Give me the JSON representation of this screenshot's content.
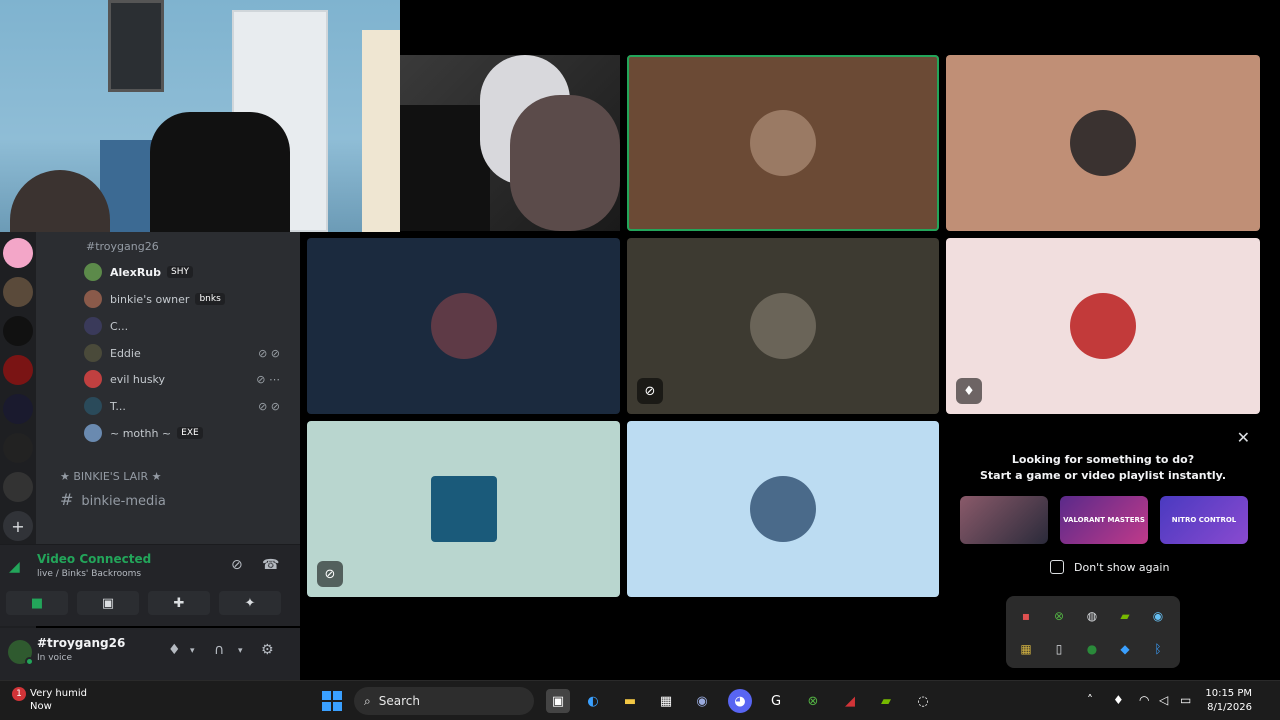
{
  "channels": {
    "text_channel": "#troygang26",
    "members": [
      {
        "name": "AlexRub",
        "tag": "SHY",
        "bright": true
      },
      {
        "name": "binkie's owner",
        "tag": "bnks",
        "bright": false
      },
      {
        "name": "C...",
        "tag": "",
        "bright": false
      },
      {
        "name": "Eddie",
        "tag": "",
        "bright": false
      },
      {
        "name": "evil husky",
        "tag": "",
        "bright": false
      },
      {
        "name": "T...",
        "tag": "",
        "bright": false
      },
      {
        "name": "~ mothh ~",
        "tag": "EXE",
        "bright": false
      }
    ],
    "category": "★ BINKIE'S LAIR ★",
    "media_channel": "binkie-media"
  },
  "voice": {
    "status": "Video Connected",
    "location": "live / Binks' Backrooms"
  },
  "user": {
    "name": "#troygang26",
    "status": "In voice"
  },
  "activity": {
    "title_line1": "Looking for something to do?",
    "title_line2": "Start a game or video playlist instantly.",
    "cards": [
      "",
      "VALORANT MASTERS",
      "NITRO CONTROL"
    ],
    "checkbox_label": "Don't show again"
  },
  "taskbar": {
    "weather_title": "Very humid",
    "weather_sub": "Now",
    "weather_badge": "1",
    "search_label": "Search",
    "time": "10:15 PM",
    "date": "8/1/2026"
  },
  "colors": {
    "online": "#23a55a",
    "tile_brown": "#6b4a35",
    "tile_salmon": "#c08f76",
    "tile_navy": "#1b2a3e",
    "tile_olive": "#3d3a31",
    "tile_pink": "#f1dede",
    "tile_mint": "#b9d6cf",
    "tile_sky": "#bcdcf2"
  }
}
